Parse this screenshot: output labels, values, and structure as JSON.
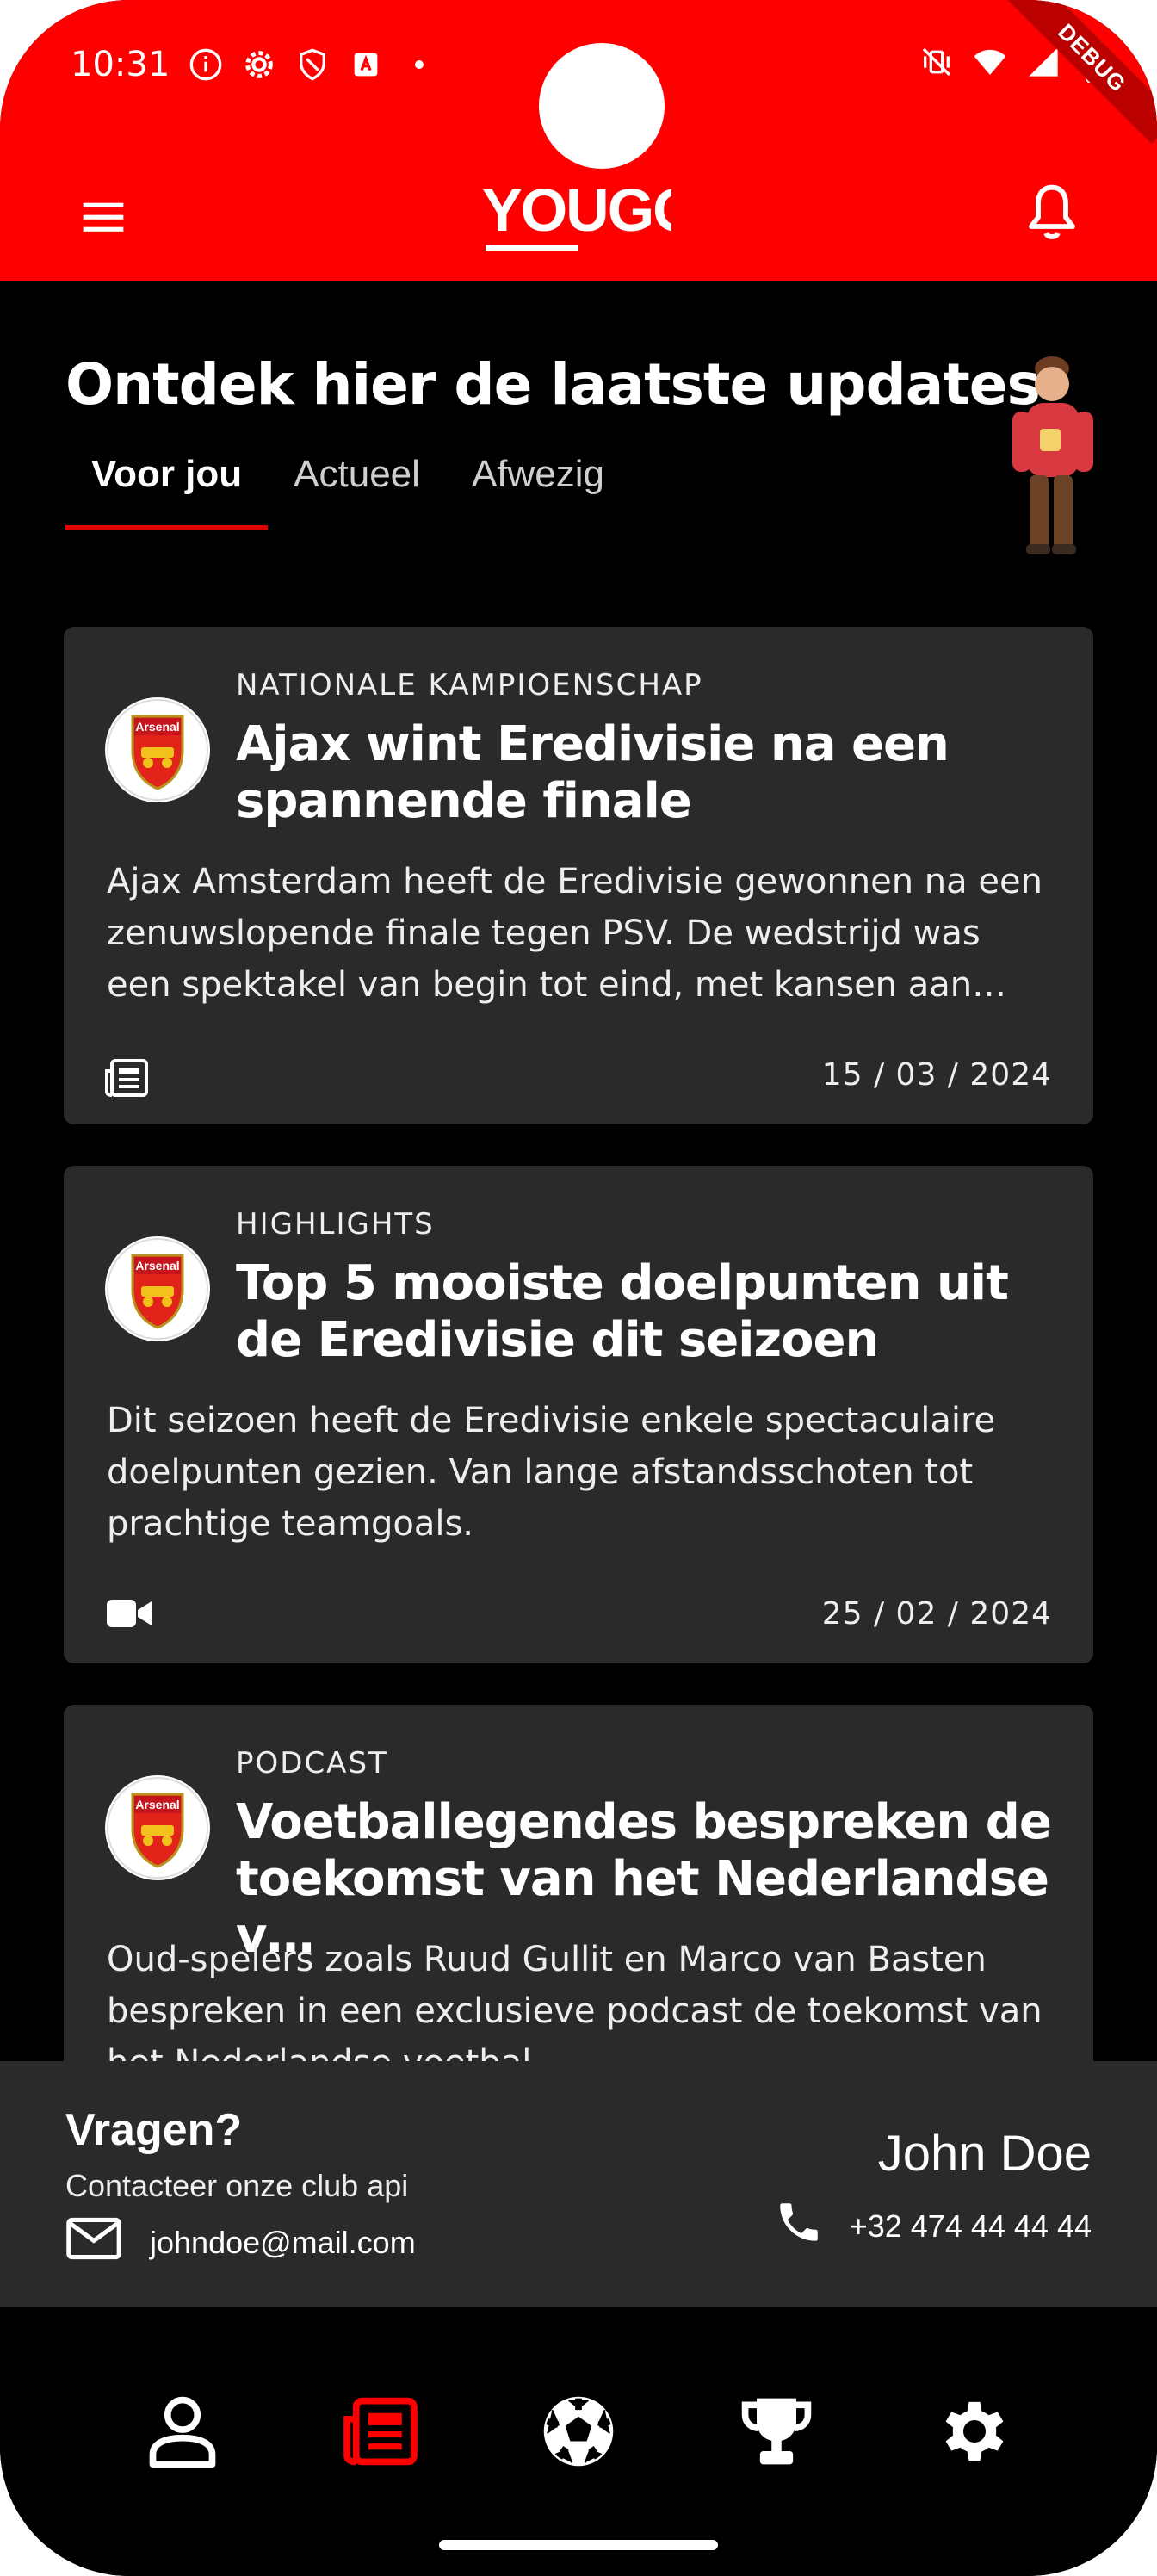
{
  "status_bar": {
    "time": "10:31",
    "debug_label": "DEBUG"
  },
  "app_bar": {
    "logo_text": "YOUGO"
  },
  "page": {
    "headline": "Ontdek hier de laatste updates",
    "tabs": [
      {
        "label": "Voor jou",
        "active": true
      },
      {
        "label": "Actueel",
        "active": false
      },
      {
        "label": "Afwezig",
        "active": false
      }
    ]
  },
  "articles": [
    {
      "category": "NATIONALE KAMPIOENSCHAP",
      "title": "Ajax wint Eredivisie na een spannende finale",
      "body": "Ajax Amsterdam heeft de Eredivisie gewonnen na een zenuwslopende finale tegen PSV. De wedstrijd was een spektakel van begin tot eind, met kansen aan beide kan…",
      "type_icon": "newspaper-icon",
      "date": "15 / 03 / 2024",
      "crest_text": "Arsenal"
    },
    {
      "category": "HIGHLIGHTS",
      "title": "Top 5 mooiste doelpunten uit de Eredivisie dit seizoen",
      "body": "Dit seizoen heeft de Eredivisie enkele spectaculaire doelpunten gezien. Van lange afstandsschoten tot prachtige teamgoals.",
      "type_icon": "video-icon",
      "date": "25 / 02 / 2024",
      "crest_text": "Arsenal"
    },
    {
      "category": "PODCAST",
      "title": "Voetballegendes bespreken de toekomst van het Nederlandse v…",
      "body": "Oud-spelers zoals Ruud Gullit en Marco van Basten bespreken in een exclusieve podcast de toekomst van het Nederlandse voetbal.",
      "crest_text": "Arsenal"
    }
  ],
  "footer": {
    "title": "Vragen?",
    "subtitle": "Contacteer onze club api",
    "email": "johndoe@mail.com",
    "contact_name": "John Doe",
    "phone": "+32 474 44 44 44"
  },
  "bottom_nav": [
    {
      "icon": "person-icon",
      "active": false
    },
    {
      "icon": "news-icon",
      "active": true
    },
    {
      "icon": "soccer-ball-icon",
      "active": false
    },
    {
      "icon": "trophy-icon",
      "active": false
    },
    {
      "icon": "settings-icon",
      "active": false
    }
  ],
  "colors": {
    "accent": "#ff0000",
    "card": "#2a2a2a",
    "background": "#000000"
  }
}
